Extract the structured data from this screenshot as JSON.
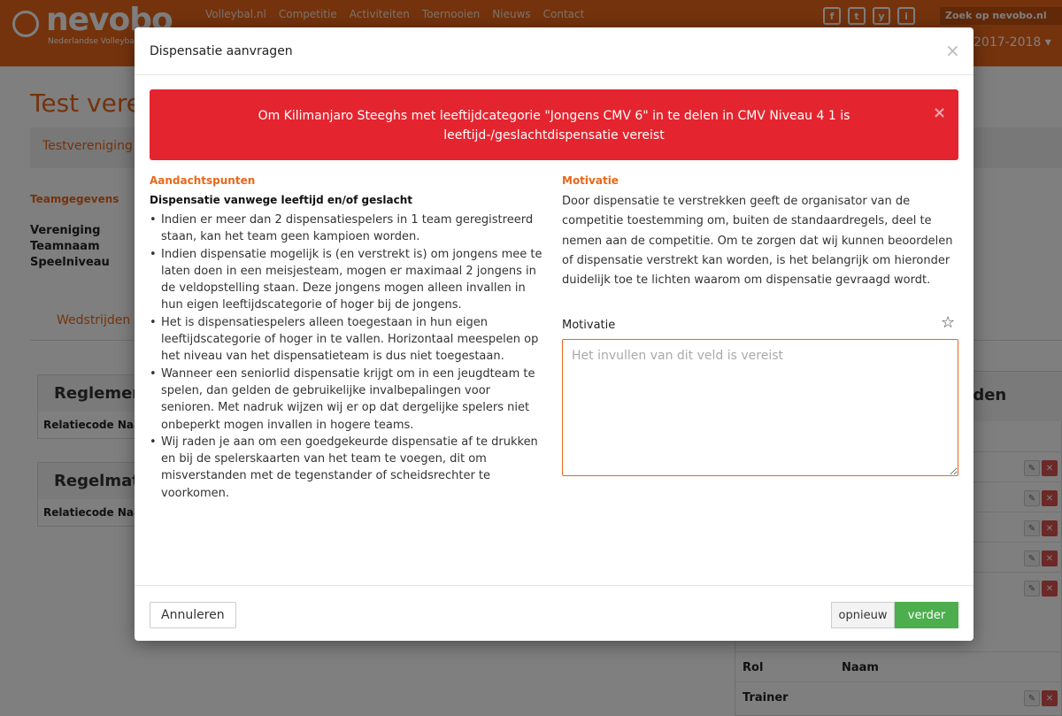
{
  "header": {
    "logo_text": "nevobo",
    "logo_sub": "Nederlandse Volleybal Bond",
    "nav": [
      "Volleybal.nl",
      "Competitie",
      "Activiteiten",
      "Toernooien",
      "Nieuws",
      "Contact"
    ],
    "social_icons": [
      "f",
      "t",
      "y",
      "i"
    ],
    "search_label": "Zoek op nevobo.nl",
    "season": "2017-2018 ▾"
  },
  "page": {
    "title": "Test verenig",
    "breadcrumb": "Testvereniging",
    "team_section": "Teamgegevens",
    "team_labels": [
      "Vereniging",
      "Teamnaam",
      "Speelniveau"
    ],
    "tab_wedstrijden": "Wedstrijden",
    "panel1_title": "Reglementair",
    "panel1_col": "Relatiecode  Naam",
    "panel2_title": "Regelmatig",
    "panel2_col": "Relatiecode  Naam",
    "right_panel_title": "ijden",
    "right_labels": [
      {
        "rol": "Rol",
        "naam": "Naam"
      },
      {
        "rol": "Trainer",
        "naam": ""
      }
    ]
  },
  "modal": {
    "title": "Dispensatie aanvragen",
    "close_icon": "×",
    "alert_text": "Om Kilimanjaro Steeghs met leeftijdcategorie \"Jongens CMV 6\" in te delen in CMV Niveau 4 1 is leeftijd-/geslachtdispensatie vereist",
    "alert_close": "×",
    "left_heading": "Aandachtspunten",
    "left_subheading": "Dispensatie vanwege leeftijd en/of geslacht",
    "points": [
      "Indien er meer dan 2 dispensatiespelers in 1 team geregistreerd staan, kan het team geen kampioen worden.",
      "Indien dispensatie mogelijk is (en verstrekt is) om jongens mee te laten doen in een meisjesteam, mogen er maximaal 2 jongens in de veldopstelling staan. Deze jongens mogen alleen invallen in hun eigen leeftijdscategorie of hoger bij de jongens.",
      "Het is dispensatiespelers alleen toegestaan in hun eigen leeftijdscategorie of hoger in te vallen. Horizontaal meespelen op het niveau van het dispensatieteam is dus niet toegestaan.",
      "Wanneer een seniorlid dispensatie krijgt om in een jeugdteam te spelen, dan gelden de gebruikelijke invalbepalingen voor senioren. Met nadruk wijzen wij er op dat dergelijke spelers niet onbeperkt mogen invallen in hogere teams.",
      "Wij raden je aan om een goedgekeurde dispensatie af te drukken en bij de spelerskaarten van het team te voegen, dit om misverstanden met de tegenstander of scheidsrechter te voorkomen."
    ],
    "right_heading": "Motivatie",
    "motivation_text": "Door dispensatie te verstrekken geeft de organisator van de competitie toestemming om, buiten de standaardregels, deel te nemen aan de competitie. Om te zorgen dat wij kunnen beoordelen of dispensatie verstrekt kan worden, is het belangrijk om hieronder duidelijk toe te lichten waarom om dispensatie gevraagd wordt.",
    "field_label": "Motivatie",
    "field_placeholder": "Het invullen van dit veld is vereist",
    "field_value": "",
    "cancel_label": "Annuleren",
    "reset_label": "opnieuw",
    "next_label": "verder"
  },
  "colors": {
    "brand": "#e8671a",
    "alert": "#e4252f",
    "success": "#4cae4c"
  }
}
